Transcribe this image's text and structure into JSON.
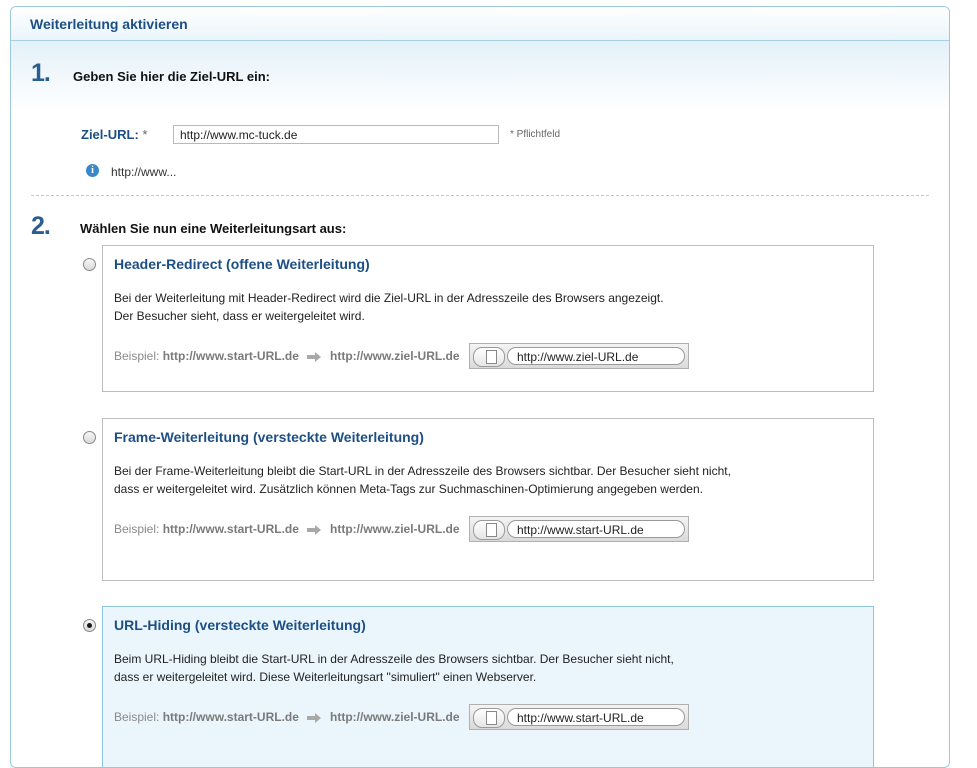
{
  "panel": {
    "title": "Weiterleitung aktivieren"
  },
  "step1": {
    "number": "1.",
    "title": "Geben Sie hier die Ziel-URL ein:",
    "label": "Ziel-URL:",
    "label_star": "*",
    "value": "http://www.mc-tuck.de",
    "required_note": "* Pflichtfeld",
    "info_icon": "info-icon",
    "hint": "http://www..."
  },
  "step2": {
    "number": "2.",
    "title": "Wählen Sie nun eine Weiterleitungsart aus:",
    "example_prefix": "Beispiel:",
    "options": [
      {
        "title": "Header-Redirect (offene Weiterleitung)",
        "desc": [
          "Bei der Weiterleitung mit Header-Redirect wird die Ziel-URL in der Adresszeile des Browsers angezeigt.",
          "Der Besucher sieht, dass er weitergeleitet wird."
        ],
        "from": "http://www.start-URL.de",
        "to": "http://www.ziel-URL.de",
        "address": "http://www.ziel-URL.de",
        "selected": false
      },
      {
        "title": "Frame-Weiterleitung (versteckte Weiterleitung)",
        "desc": [
          "Bei der Frame-Weiterleitung bleibt die Start-URL in der Adresszeile des Browsers sichtbar. Der Besucher sieht nicht,",
          "dass er weitergeleitet wird. Zusätzlich können Meta-Tags zur Suchmaschinen-Optimierung angegeben werden."
        ],
        "from": "http://www.start-URL.de",
        "to": "http://www.ziel-URL.de",
        "address": "http://www.start-URL.de",
        "selected": false
      },
      {
        "title": "URL-Hiding (versteckte Weiterleitung)",
        "desc": [
          "Beim URL-Hiding bleibt die Start-URL in der Adresszeile des Browsers sichtbar. Der Besucher sieht nicht,",
          "dass er weitergeleitet wird. Diese Weiterleitungsart \"simuliert\" einen Webserver."
        ],
        "from": "http://www.start-URL.de",
        "to": "http://www.ziel-URL.de",
        "address": "http://www.start-URL.de",
        "selected": true
      }
    ]
  },
  "colors": {
    "accent": "#1d4f86",
    "selected_bg": "#eaf6fc",
    "border": "#9cc7dc"
  }
}
